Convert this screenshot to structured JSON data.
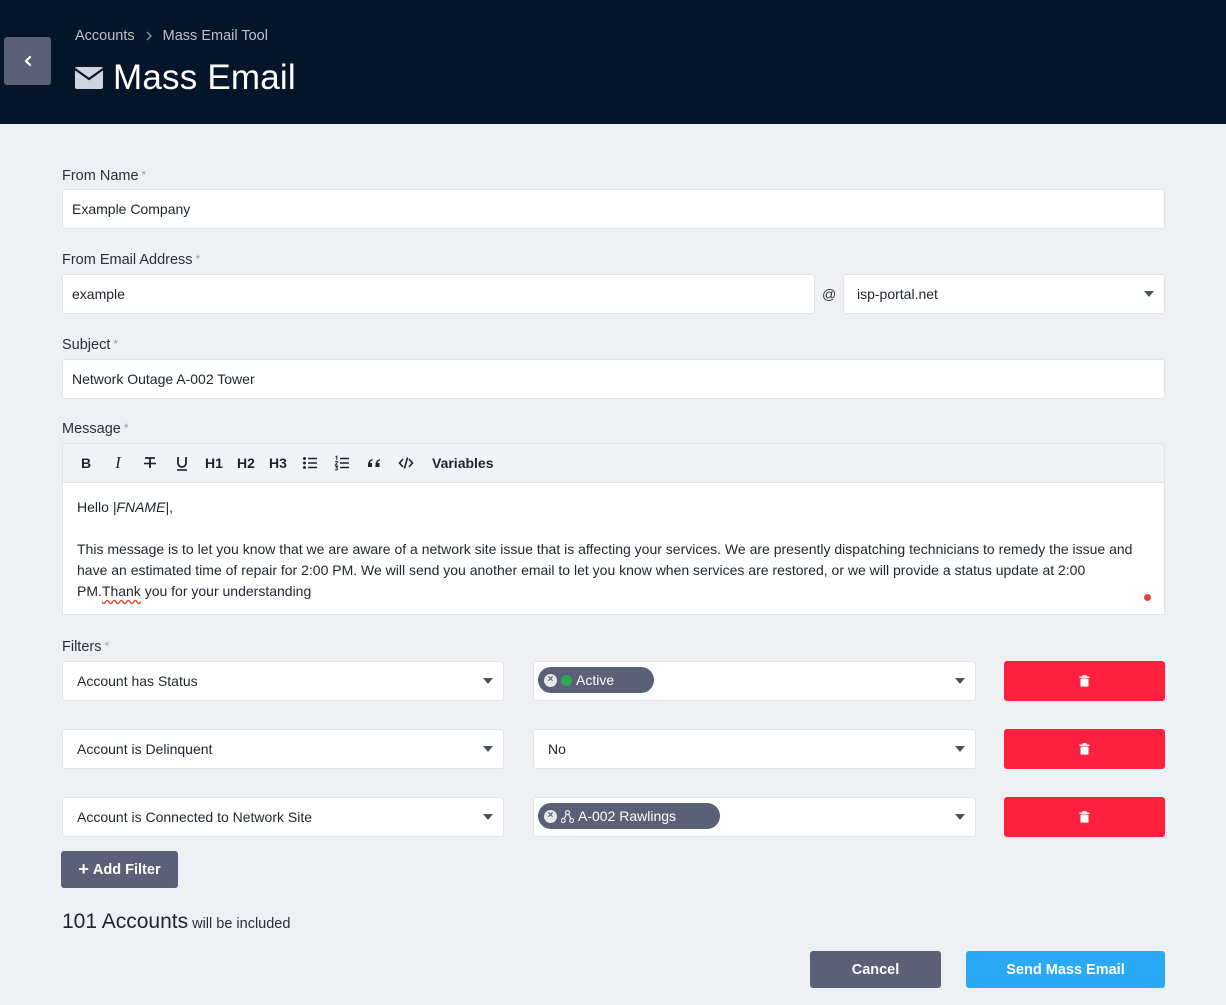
{
  "header": {
    "breadcrumb": [
      "Accounts",
      "Mass Email Tool"
    ],
    "title": "Mass Email"
  },
  "form": {
    "from_name": {
      "label": "From Name",
      "required": "*",
      "value": "Example Company"
    },
    "from_email": {
      "label": "From Email Address",
      "required": "*",
      "value": "example",
      "at": "@",
      "domain": "isp-portal.net"
    },
    "subject": {
      "label": "Subject",
      "required": "*",
      "value": "Network Outage A-002 Tower"
    },
    "message": {
      "label": "Message",
      "required": "*",
      "toolbar": [
        "B",
        "I",
        "strikethrough",
        "underline",
        "H1",
        "H2",
        "H3",
        "bullet-list",
        "numbered-list",
        "quote",
        "code",
        "Variables"
      ],
      "greeting_prefix": "Hello ",
      "greeting_var": "|FNAME|",
      "greeting_suffix": ",",
      "body_main": "This message is to let you know that we are aware of a network site issue that is affecting your services. We are presently dispatching technicians to remedy the issue and have an estimated time of repair for 2:00 PM. We will send you another email to let you know when services are restored, or we will provide a status update at 2:00 PM.",
      "body_misspelled": "Thank",
      "body_end": " you for your understanding"
    }
  },
  "filters": {
    "label": "Filters",
    "required": "*",
    "rows": [
      {
        "field": "Account has Status",
        "value_chip": "Active",
        "value_icon": "status-dot"
      },
      {
        "field": "Account is Delinquent",
        "value_text": "No"
      },
      {
        "field": "Account is Connected to Network Site",
        "value_chip": "A-002 Rawlings",
        "value_icon": "network-icon"
      }
    ],
    "add_label": "Add Filter"
  },
  "summary": {
    "count": "101 Accounts",
    "rest": "will be included"
  },
  "actions": {
    "cancel": "Cancel",
    "send": "Send Mass Email"
  },
  "colors": {
    "header_bg": "#06162a",
    "danger": "#ff1f3e",
    "primary": "#2aa9f5",
    "secondary": "#5a6176",
    "status_active": "#2fa84f"
  }
}
